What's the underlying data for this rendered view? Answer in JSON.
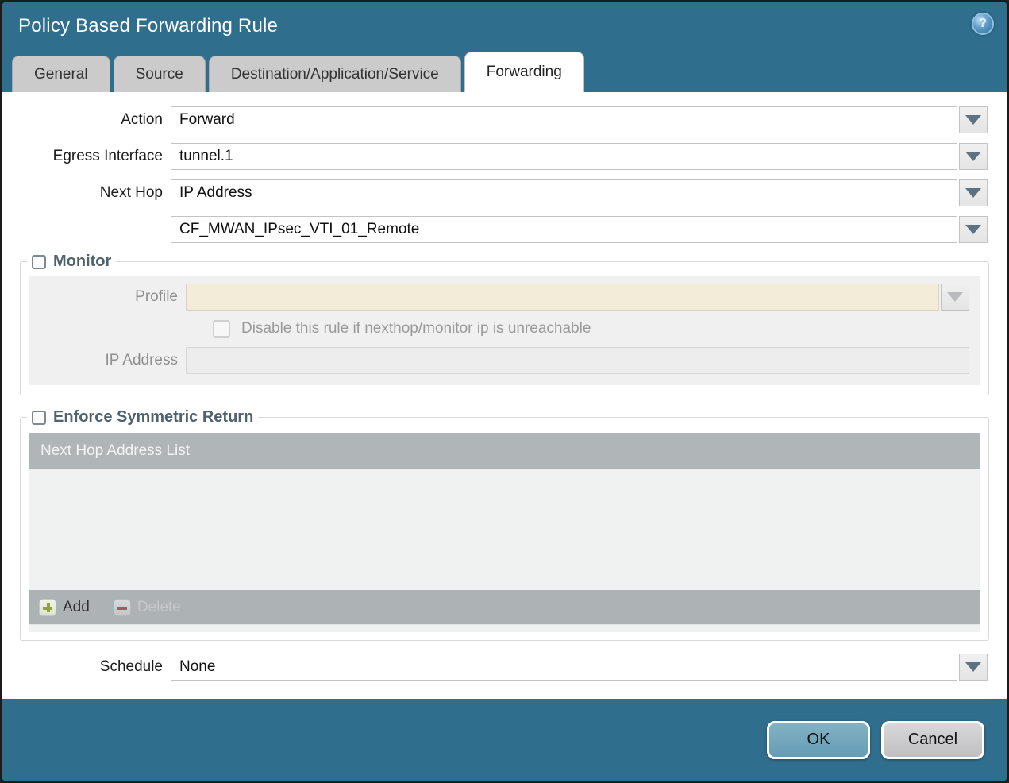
{
  "window": {
    "title": "Policy Based Forwarding Rule"
  },
  "tabs": [
    {
      "label": "General",
      "active": false
    },
    {
      "label": "Source",
      "active": false
    },
    {
      "label": "Destination/Application/Service",
      "active": false
    },
    {
      "label": "Forwarding",
      "active": true
    }
  ],
  "form": {
    "action": {
      "label": "Action",
      "value": "Forward"
    },
    "egress_interface": {
      "label": "Egress Interface",
      "value": "tunnel.1"
    },
    "next_hop": {
      "label": "Next Hop",
      "value": "IP Address"
    },
    "next_hop_address": {
      "value": "CF_MWAN_IPsec_VTI_01_Remote"
    },
    "schedule": {
      "label": "Schedule",
      "value": "None"
    }
  },
  "monitor": {
    "legend": "Monitor",
    "checked": false,
    "profile": {
      "label": "Profile",
      "value": ""
    },
    "disable_rule": {
      "label": "Disable this rule if nexthop/monitor ip is unreachable",
      "checked": false
    },
    "ip_address": {
      "label": "IP Address",
      "value": ""
    }
  },
  "symmetric_return": {
    "legend": "Enforce Symmetric Return",
    "checked": false,
    "table": {
      "header": "Next Hop Address List",
      "rows": []
    },
    "add_label": "Add",
    "delete_label": "Delete"
  },
  "footer": {
    "ok_label": "OK",
    "cancel_label": "Cancel"
  },
  "icons": {
    "help": "help-icon",
    "chevron": "chevron-down-icon",
    "plus": "plus-icon",
    "minus": "minus-icon"
  },
  "colors": {
    "titlebar_teal": "#306e8e",
    "tab_gray": "#cbcbcb",
    "active_tab": "#ffffff",
    "legend_text": "#50616f",
    "profile_field_beige": "#f2ecd9",
    "table_header_gray": "#b0b5b8",
    "table_body_gray": "#f0f1f1",
    "table_footer_gray": "#adb2b5",
    "ok_button_teal": "#6ba3bb",
    "cancel_button_gray": "#c9c9cb",
    "plus_green": "#93a23c",
    "minus_red": "#a8585c"
  }
}
